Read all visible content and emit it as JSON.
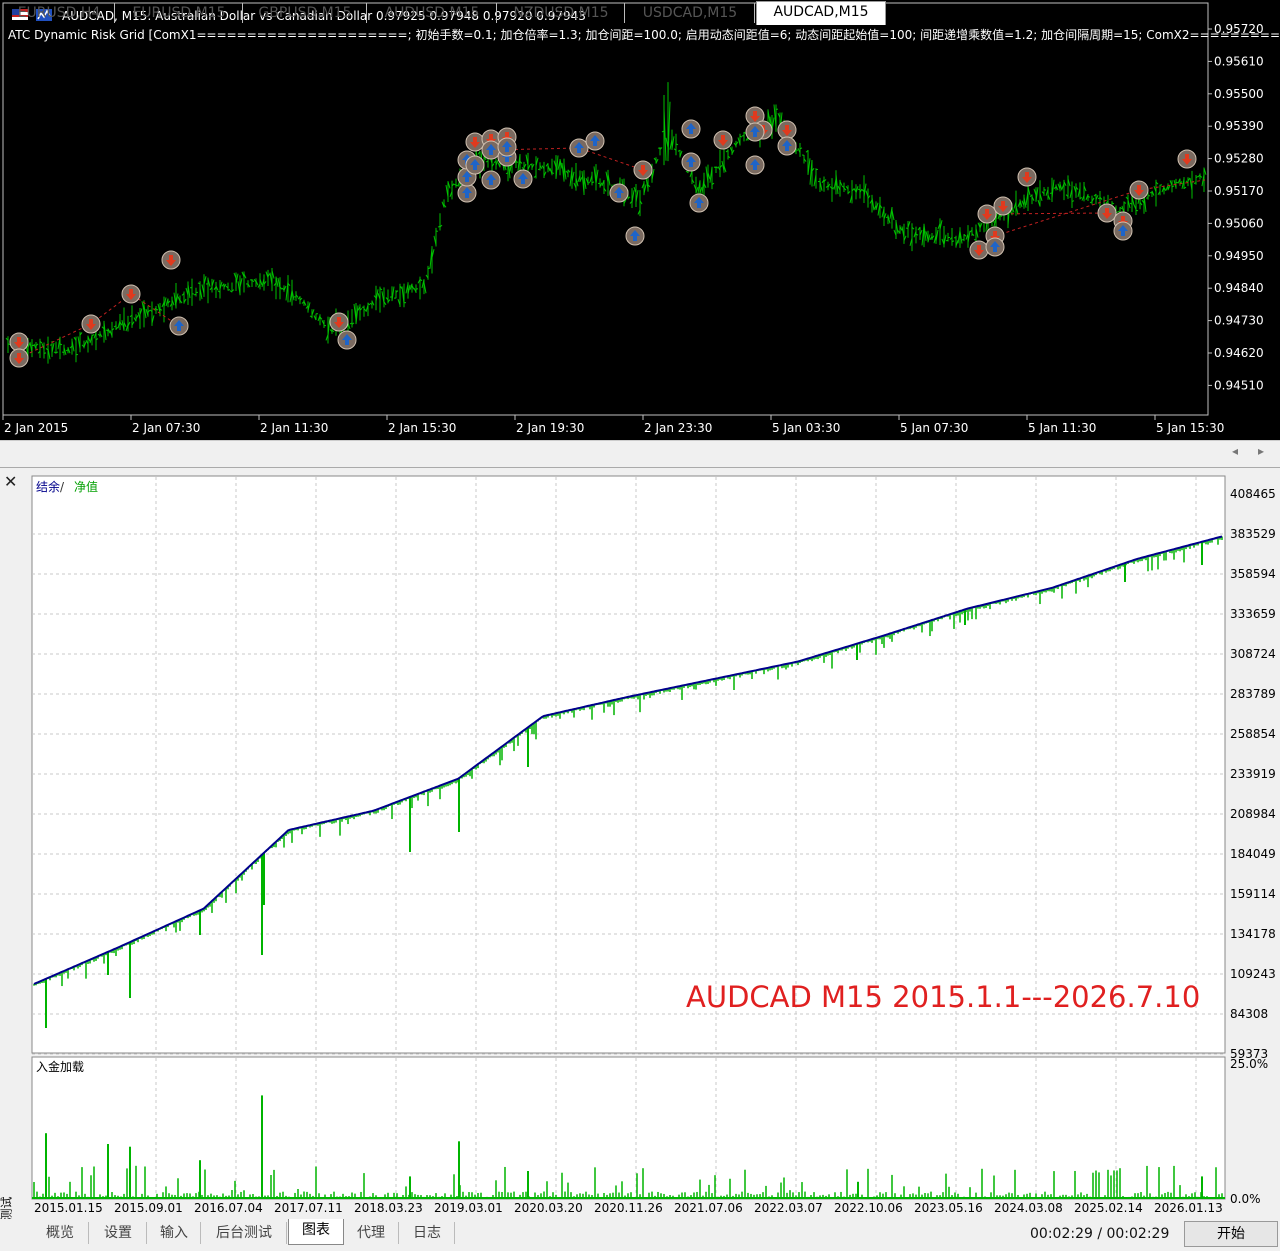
{
  "chart": {
    "header": "AUDCAD, M15:  Australian Dollar vs Canadian Dollar  0.97925 0.97948 0.97920 0.97943",
    "indicator": "ATC Dynamic Risk Grid [ComX1=====================; 初始手数=0.1; 加仓倍率=1.3; 加仓间距=100.0; 启用动态间距值=6; 动态间距起始值=100; 间距递增乘数值=1.2; 加仓间隔周期=15; ComX2=========",
    "price_labels": [
      "0.95720",
      "0.95610",
      "0.95500",
      "0.95390",
      "0.95280",
      "0.95170",
      "0.95060",
      "0.94950",
      "0.94840",
      "0.94730",
      "0.94620",
      "0.94510"
    ],
    "time_labels": [
      "2 Jan 2015",
      "2 Jan 07:30",
      "2 Jan 11:30",
      "2 Jan 15:30",
      "2 Jan 19:30",
      "2 Jan 23:30",
      "5 Jan 03:30",
      "5 Jan 07:30",
      "5 Jan 11:30",
      "5 Jan 15:30"
    ],
    "colors": {
      "bg": "#000000",
      "bar": "#00c000",
      "buy_arrow": "#1e64c8",
      "sell_arrow": "#e03a1e",
      "text": "#ffffff"
    }
  },
  "symbol_tabs": [
    "EURUSD,H4",
    "EURUSD,M15",
    "GBPUSD,M15",
    "AUDUSD,M15",
    "NZDUSD,M15",
    "USDCAD,M15",
    "AUDCAD,M15"
  ],
  "active_symbol_tab": "AUDCAD,M15",
  "tester": {
    "side_title": "策略测试",
    "legend_balance": "结余",
    "legend_sep": " / ",
    "legend_equity": "净值",
    "overlay_label": "AUDCAD M15 2015.1.1---2026.7.10",
    "load_label": "入金加载",
    "y_labels": [
      "408465",
      "383529",
      "358594",
      "333659",
      "308724",
      "283789",
      "258854",
      "233919",
      "208984",
      "184049",
      "159114",
      "134178",
      "109243",
      "84308",
      "59373"
    ],
    "load_y_labels": [
      "25.0%",
      "0.0%"
    ],
    "x_labels": [
      "2015.01.15",
      "2015.09.01",
      "2016.07.04",
      "2017.07.11",
      "2018.03.23",
      "2019.03.01",
      "2020.03.20",
      "2020.11.26",
      "2021.07.06",
      "2022.03.07",
      "2022.10.06",
      "2023.05.16",
      "2024.03.08",
      "2025.02.14",
      "2026.01.13"
    ],
    "colors": {
      "balance": "#00008b",
      "equity": "#00b400",
      "load": "#00b400",
      "overlay": "#e02020"
    }
  },
  "chart_data": [
    {
      "type": "line",
      "title": "",
      "xlabel": "",
      "ylabel": "",
      "x": [
        "2015.01.15",
        "2015.09.01",
        "2016.07.04",
        "2017.07.11",
        "2018.03.23",
        "2019.03.01",
        "2020.03.20",
        "2020.11.26",
        "2021.07.06",
        "2022.03.07",
        "2022.10.06",
        "2023.05.16",
        "2024.03.08",
        "2025.02.14",
        "2026.01.13"
      ],
      "series": [
        {
          "name": "结余",
          "values": [
            103000,
            126000,
            150000,
            199000,
            211000,
            231000,
            270000,
            282000,
            293000,
            304000,
            320000,
            337000,
            350000,
            368000,
            382000
          ]
        }
      ],
      "ylim": [
        59373,
        420000
      ],
      "grid": true
    },
    {
      "type": "bar",
      "title": "",
      "ylabel": "入金加载",
      "ylim": [
        0,
        25.0
      ],
      "categories": [
        "2015.01.15",
        "2015.09.01",
        "2016.07.04",
        "2017.07.11",
        "2018.03.23",
        "2019.03.01",
        "2020.03.20",
        "2020.11.26",
        "2021.07.06",
        "2022.03.07",
        "2022.10.06",
        "2023.05.16",
        "2024.03.08",
        "2025.02.14",
        "2026.01.13"
      ],
      "values": [
        12,
        10,
        19,
        7,
        4,
        10,
        5,
        3,
        3,
        3,
        3,
        3,
        3,
        3,
        4
      ]
    }
  ],
  "bottom_tabs": [
    "概览",
    "设置",
    "输入",
    "后台测试",
    "图表",
    "代理",
    "日志"
  ],
  "active_bottom_tab": "图表",
  "timer": "00:02:29 / 00:02:29",
  "start_button": "开始"
}
